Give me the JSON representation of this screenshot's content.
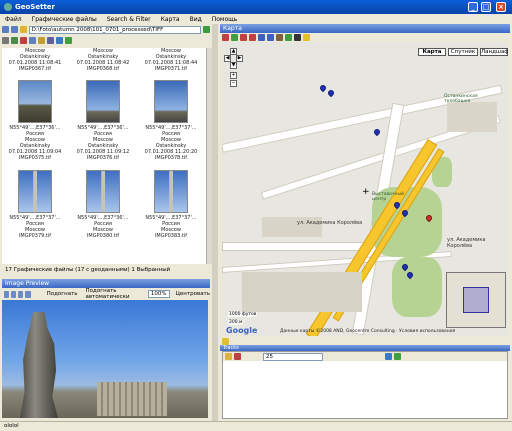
{
  "app": {
    "title": "GeoSetter",
    "window_buttons": [
      "_",
      "□",
      "×"
    ]
  },
  "menu": [
    "Файл",
    "Графические файлы",
    "Search & Filter",
    "Карта",
    "Вид",
    "Помощь"
  ],
  "file_panel": {
    "path": "D:\\Foto\\autumn 2008\\101_0701_processed\\TIFF",
    "top_labels": [
      "Moscow",
      "Moscow",
      "Moscow"
    ],
    "thumbnails": [
      {
        "lines": [
          "Ostankinsky",
          "07.01.2008 11:08:41",
          "IMGP0367.tif"
        ]
      },
      {
        "lines": [
          "Ostankinsky",
          "07.01.2008 11:08:42",
          "IMGP0368.tif"
        ]
      },
      {
        "lines": [
          "Ostankinsky",
          "07.01.2008 11:08:44",
          "IMGP0371.tif"
        ]
      },
      {
        "lines": [
          "N55°49'...,E37°36'...",
          "Россия",
          "Moscow",
          "Ostankinsky",
          "07.01.2008 11:09:04",
          "IMGP0375.tif"
        ]
      },
      {
        "lines": [
          "N55°49'...,E37°36'...",
          "Россия",
          "Moscow",
          "Ostankinsky",
          "07.01.2008 11:09:12",
          "IMGP0376.tif"
        ]
      },
      {
        "lines": [
          "N55°49'...,E37°37'...",
          "Россия",
          "Moscow",
          "Ostankinsky",
          "07.01.2008 11:20:20",
          "IMGP0378.tif"
        ]
      },
      {
        "lines": [
          "N55°49'...,E37°37'...",
          "Россия",
          "Moscow",
          "",
          "",
          "IMGP0379.tif"
        ]
      },
      {
        "lines": [
          "N55°49'...,E37°36'...",
          "Россия",
          "Moscow",
          "",
          "",
          "IMGP0380.tif"
        ]
      },
      {
        "lines": [
          "N55°49'...,E37°37'...",
          "Россия",
          "Moscow",
          "",
          "",
          "IMGP0383.tif"
        ]
      }
    ],
    "status": "17 Графические файлы  (17 с geoданными)  1 Выбранный"
  },
  "image_preview": {
    "title": "Image Preview",
    "fit_label": "Подогнать",
    "auto_fit_label": "Подогнать автоматически",
    "zoom": "100%",
    "center_label": "Центровать"
  },
  "map": {
    "title": "Карта",
    "tabs": [
      "Карта",
      "Спутник",
      "Ландшафт"
    ],
    "labels": [
      "ул. Академика Королёва",
      "ул. Академика Королёва",
      "Выставочный центр",
      "Останкинская телебашня"
    ],
    "scale": [
      "1000 футов",
      "200 м"
    ],
    "copyright": "Данные карты ©2008 AND, Geocentre Consulting · Условия использования",
    "google": "Google"
  },
  "tracks": {
    "title": "Tracks",
    "select_value": "25"
  },
  "footer": {
    "text": "ololol"
  },
  "colors": {
    "titlebar": "#0842a8",
    "pane_header": "#3a68c4",
    "pin": "#2330b8",
    "highway": "#f7c52c"
  }
}
